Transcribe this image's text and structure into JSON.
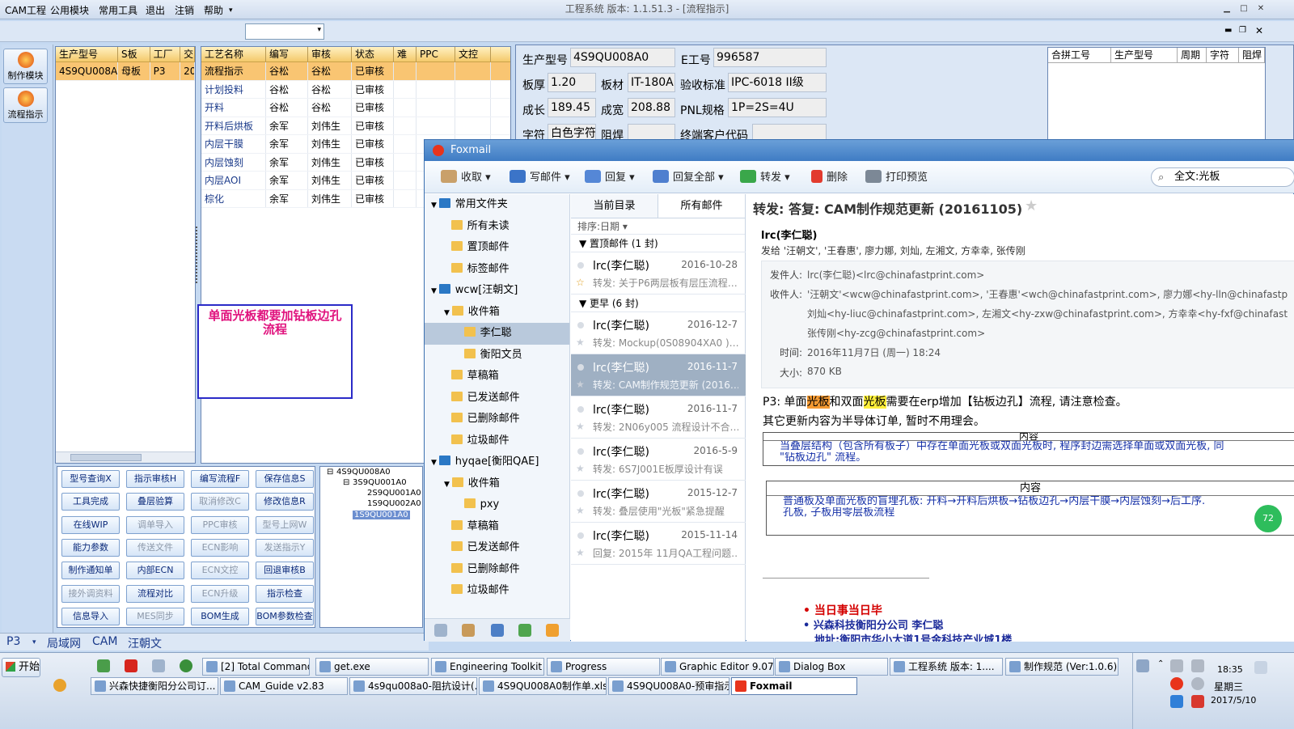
{
  "app": {
    "title": "工程系统  版本: 1.1.51.3 - [流程指示]"
  },
  "menu": {
    "items": [
      "CAM工程",
      "公用模块",
      "常用工具",
      "退出",
      "注销",
      "帮助"
    ]
  },
  "nav": {
    "items": [
      "制作模块",
      "流程指示"
    ]
  },
  "grid1": {
    "headers": [
      "生产型号",
      "S板",
      "工厂",
      "交"
    ],
    "rows": [
      [
        "4S9QU008A0",
        "母板",
        "P3",
        "20"
      ]
    ]
  },
  "grid2": {
    "headers": [
      "工艺名称",
      "编写",
      "审核",
      "状态",
      "难",
      "PPC",
      "文控"
    ],
    "rows": [
      [
        "流程指示",
        "谷松",
        "谷松",
        "已审核"
      ],
      [
        "计划投料",
        "谷松",
        "谷松",
        "已审核"
      ],
      [
        "开料",
        "谷松",
        "谷松",
        "已审核"
      ],
      [
        "开料后烘板",
        "余军",
        "刘伟生",
        "已审核"
      ],
      [
        "内层干膜",
        "余军",
        "刘伟生",
        "已审核"
      ],
      [
        "内层蚀刻",
        "余军",
        "刘伟生",
        "已审核"
      ],
      [
        "内层AOI",
        "余军",
        "刘伟生",
        "已审核"
      ],
      [
        "棕化",
        "余军",
        "刘伟生",
        "已审核"
      ]
    ]
  },
  "note": "单面光板都要加钻板边孔流程",
  "form": {
    "labels": [
      "生产型号",
      "E工号",
      "板厚",
      "板材",
      "验收标准",
      "成长",
      "成宽",
      "PNL规格",
      "字符",
      "阻焊",
      "终端客户代码"
    ],
    "values": [
      "4S9QU008A0",
      "996587",
      "1.20",
      "IT-180A",
      "IPC-6018 II级",
      "189.45",
      "208.88",
      "1P=2S=4U",
      "白色字符",
      "",
      ""
    ]
  },
  "rgrid": {
    "headers": [
      "合拼工号",
      "生产型号",
      "周期",
      "字符",
      "阻焊"
    ]
  },
  "buttons": [
    [
      "型号查询X",
      "指示审核H",
      "编写流程F",
      "保存信息S"
    ],
    [
      "工具完成",
      "叠层验算",
      "取消修改C",
      "修改信息R"
    ],
    [
      "在线WIP",
      "调单导入",
      "PPC审核",
      "型号上网W"
    ],
    [
      "能力参数",
      "传送文件",
      "ECN影响",
      "发送指示Y"
    ],
    [
      "制作通知单",
      "内部ECN",
      "ECN文控",
      "回退审核B"
    ],
    [
      "接外调资料",
      "流程对比",
      "ECN升级",
      "指示检查"
    ],
    [
      "信息导入",
      "MES同步",
      "BOM生成",
      "BOM参数检查"
    ]
  ],
  "tree": [
    "4S9QU008A0",
    "3S9QU001A0",
    "2S9QU001A0",
    "1S9QU002A0",
    "1S9QU001A0"
  ],
  "status": [
    "P3",
    "局域网",
    "CAM",
    "汪朝文"
  ],
  "foxmail": {
    "title": "Foxmail",
    "toolbar": [
      "收取",
      "写邮件",
      "回复",
      "回复全部",
      "转发",
      "删除",
      "打印预览"
    ],
    "search": "全文:光板",
    "folders": [
      {
        "label": "常用文件夹",
        "level": 0
      },
      {
        "label": "所有未读",
        "level": 1
      },
      {
        "label": "置顶邮件",
        "level": 1
      },
      {
        "label": "标签邮件",
        "level": 1
      },
      {
        "label": "wcw[汪朝文]",
        "level": 0
      },
      {
        "label": "收件箱",
        "level": 1
      },
      {
        "label": "李仁聪",
        "level": 2
      },
      {
        "label": "衡阳文员",
        "level": 2
      },
      {
        "label": "草稿箱",
        "level": 1
      },
      {
        "label": "已发送邮件",
        "level": 1
      },
      {
        "label": "已删除邮件",
        "level": 1
      },
      {
        "label": "垃圾邮件",
        "level": 1
      },
      {
        "label": "hyqae[衡阳QAE]",
        "level": 0
      },
      {
        "label": "收件箱",
        "level": 1
      },
      {
        "label": "pxy",
        "level": 2
      },
      {
        "label": "草稿箱",
        "level": 1
      },
      {
        "label": "已发送邮件",
        "level": 1
      },
      {
        "label": "已删除邮件",
        "level": 1
      },
      {
        "label": "垃圾邮件",
        "level": 1
      }
    ],
    "list_tabs": [
      "当前目录",
      "所有邮件"
    ],
    "sort": "排序:日期",
    "groups": [
      "置顶邮件 (1 封)",
      "更早 (6 封)"
    ],
    "mails": [
      {
        "from": "lrc(李仁聪)",
        "date": "2016-10-28",
        "subject": "转发: 关于P6两层板有层压流程…"
      },
      {
        "from": "lrc(李仁聪)",
        "date": "2016-12-7",
        "subject": "转发: Mockup(0S08904XA0 )…"
      },
      {
        "from": "lrc(李仁聪)",
        "date": "2016-11-7",
        "subject": "转发: CAM制作规范更新 (2016…"
      },
      {
        "from": "lrc(李仁聪)",
        "date": "2016-11-7",
        "subject": "转发: 2N06y005 流程设计不合…"
      },
      {
        "from": "lrc(李仁聪)",
        "date": "2016-5-9",
        "subject": "转发: 6S7J001E板厚设计有误"
      },
      {
        "from": "lrc(李仁聪)",
        "date": "2015-12-7",
        "subject": "转发: 叠层使用\"光板\"紧急提醒"
      },
      {
        "from": "lrc(李仁聪)",
        "date": "2015-11-14",
        "subject": "回复: 2015年 11月QA工程问题…"
      }
    ],
    "read": {
      "subject": "转发: 答复: CAM制作规范更新 (20161105)",
      "sender": "lrc(李仁聪)",
      "sendto": "发给 '汪朝文', '王春惠', 廖力娜, 刘灿, 左湘文, 方幸幸, 张传刚",
      "from_label": "发件人:",
      "from": "lrc(李仁聪)<lrc@chinafastprint.com>",
      "to_label": "收件人:",
      "to1": "'汪朝文'<wcw@chinafastprint.com>, '王春惠'<wch@chinafastprint.com>, 廖力娜<hy-lln@chinafastp",
      "to2": "刘灿<hy-liuc@chinafastprint.com>, 左湘文<hy-zxw@chinafastprint.com>, 方幸幸<hy-fxf@chinafast",
      "to3": "张传刚<hy-zcg@chinafastprint.com>",
      "time_label": "时间:",
      "time": "2016年11月7日 (周一) 18:24",
      "size_label": "大小:",
      "size": "870 KB",
      "body1a": "P3: 单面",
      "body1b": "光板",
      "body1c": "和双面",
      "body1d": "光板",
      "body1e": "需要在erp增加【钻板边孔】流程, 请注意检查。",
      "body2": "其它更新内容为半导体订单, 暂时不用理会。",
      "t1_header": "内容",
      "t1_text": "当叠层结构（包含所有板子）中存在单面光板或双面光板时, 程序封边需选择单面或双面光板, 同",
      "t1_text2": "\"钻板边孔\" 流程。",
      "t2_header": "内容",
      "t2_text": "普通板及单面光板的盲埋孔板: 开料→开料后烘板→钻板边孔→内层干膜→内层蚀刻→后工序.",
      "t2_text2": "孔板, 子板用零层板流程",
      "sig1": "当日事当日毕",
      "sig2": "兴森科技衡阳分公司  李仁聪",
      "sig3": "地址:衡阳市华小大道1号金科技产业城1楼",
      "badge": "72"
    }
  },
  "taskbar": {
    "start": "开始",
    "row1": [
      "[2] Total Commander ...",
      "get.exe",
      "Engineering Toolkit 9....",
      "Progress",
      "Graphic Editor 9.07b2...",
      "Dialog Box",
      "工程系统  版本: 1....",
      "制作规范 (Ver:1.0.6)"
    ],
    "row2": [
      "兴森快捷衡阳分公司订...",
      "CAM_Guide v2.83",
      "4s9qu008a0-阻抗设计(...",
      "4S9QU008A0制作单.xls ...",
      "4S9QU008A0-预审指示....",
      "Foxmail"
    ],
    "time": "18:35",
    "weekday": "星期三",
    "date": "2017/5/10"
  }
}
